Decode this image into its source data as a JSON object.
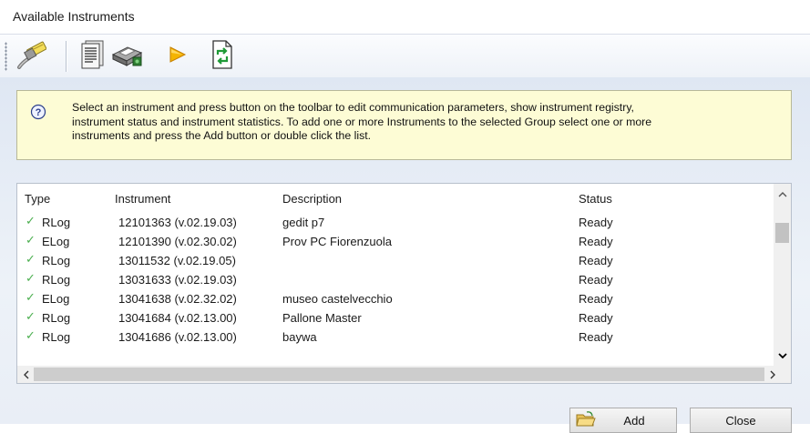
{
  "window": {
    "title": "Available Instruments"
  },
  "toolbar": {
    "buttons": [
      {
        "name": "communication-parameters",
        "icon": "serial-cable-icon"
      },
      {
        "name": "instrument-registry",
        "icon": "document-list-icon"
      },
      {
        "name": "instrument-status",
        "icon": "status-printer-icon"
      },
      {
        "name": "instrument-statistics",
        "icon": "play-arrow-icon"
      },
      {
        "name": "refresh",
        "icon": "refresh-document-icon"
      }
    ]
  },
  "info": {
    "icon": "help-question-icon",
    "line1": "Select an instrument and press button on the toolbar to edit communication parameters, show instrument registry,",
    "line2": "instrument status and instrument statistics. To add one or more Instruments to the selected Group select one or more",
    "line3": "instruments and press the Add button or double click the list."
  },
  "list": {
    "columns": {
      "type": "Type",
      "instrument": "Instrument",
      "description": "Description",
      "status": "Status"
    },
    "rows": [
      {
        "type": "RLog",
        "instrument": "12101363 (v.02.19.03)",
        "description": "gedit p7",
        "status": "Ready"
      },
      {
        "type": "ELog",
        "instrument": "12101390 (v.02.30.02)",
        "description": "Prov PC Fiorenzuola",
        "status": "Ready"
      },
      {
        "type": "RLog",
        "instrument": "13011532 (v.02.19.05)",
        "description": "",
        "status": "Ready"
      },
      {
        "type": "RLog",
        "instrument": "13031633 (v.02.19.03)",
        "description": "",
        "status": "Ready"
      },
      {
        "type": "ELog",
        "instrument": "13041638 (v.02.32.02)",
        "description": "museo castelvecchio",
        "status": "Ready"
      },
      {
        "type": "RLog",
        "instrument": "13041684 (v.02.13.00)",
        "description": "Pallone Master",
        "status": "Ready"
      },
      {
        "type": "RLog",
        "instrument": "13041686 (v.02.13.00)",
        "description": "baywa",
        "status": "Ready"
      }
    ],
    "check_glyph": "✓"
  },
  "buttons": {
    "add": "Add",
    "close": "Close"
  },
  "colors": {
    "info_bg": "#fdfcd5",
    "check_green": "#4caf50",
    "content_bg": "#e4ebf5"
  }
}
